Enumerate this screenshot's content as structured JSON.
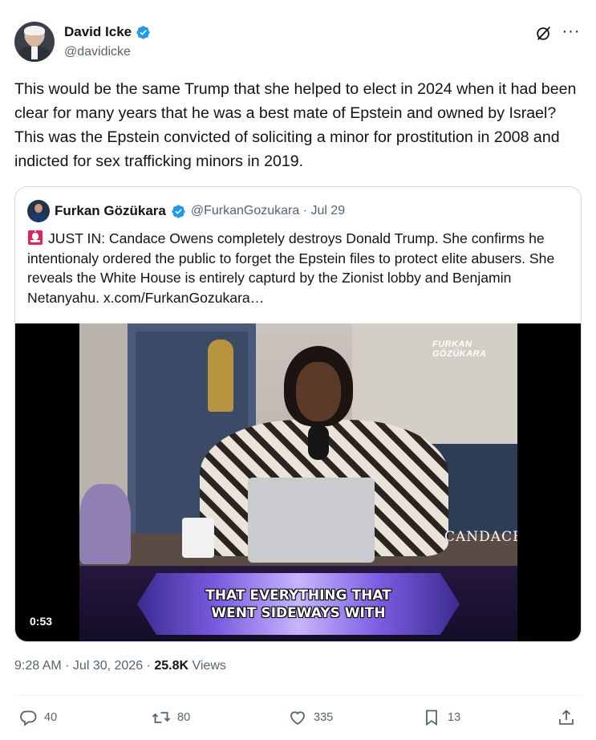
{
  "author": {
    "display_name": "David Icke",
    "handle": "@davidicke"
  },
  "tweet": {
    "text": "This would be the same Trump that she helped to elect in 2024 when it had been clear for many years that he was a best mate of Epstein and owned by Israel? This was the Epstein convicted of soliciting a minor for prostitution in 2008 and indicted for sex trafficking minors in 2019."
  },
  "quote": {
    "display_name": "Furkan Gözükara",
    "handle_date": "@FurkanGozukara · Jul 29",
    "text": "JUST IN: Candace Owens completely destroys Donald Trump.  She confirms he intentionaly ordered the public to forget the Epstein files to protect elite abusers. She reveals the White House is entirely capturd by the Zionist lobby and Benjamin Netanyahu.  x.com/FurkanGozukara…",
    "video": {
      "watermark": "FURKAN GÖZÜKARA",
      "brand": "CANDACE",
      "caption_line1": "THAT EVERYTHING THAT",
      "caption_line2": "WENT SIDEWAYS WITH",
      "duration": "0:53"
    }
  },
  "meta": {
    "timestamp": "9:28 AM · Jul 30, 2026 · ",
    "views_count": "25.8K",
    "views_label": " Views"
  },
  "actions": {
    "replies": "40",
    "reposts": "80",
    "likes": "335",
    "bookmarks": "13"
  },
  "colors": {
    "verified": "#1d9bf0",
    "text_primary": "#0f1419",
    "text_secondary": "#536471",
    "border": "#cfd9de"
  },
  "icons": [
    "verified-badge-icon",
    "grok-icon",
    "more-icon",
    "siren-icon",
    "reply-icon",
    "repost-icon",
    "like-icon",
    "bookmark-icon",
    "share-icon"
  ]
}
